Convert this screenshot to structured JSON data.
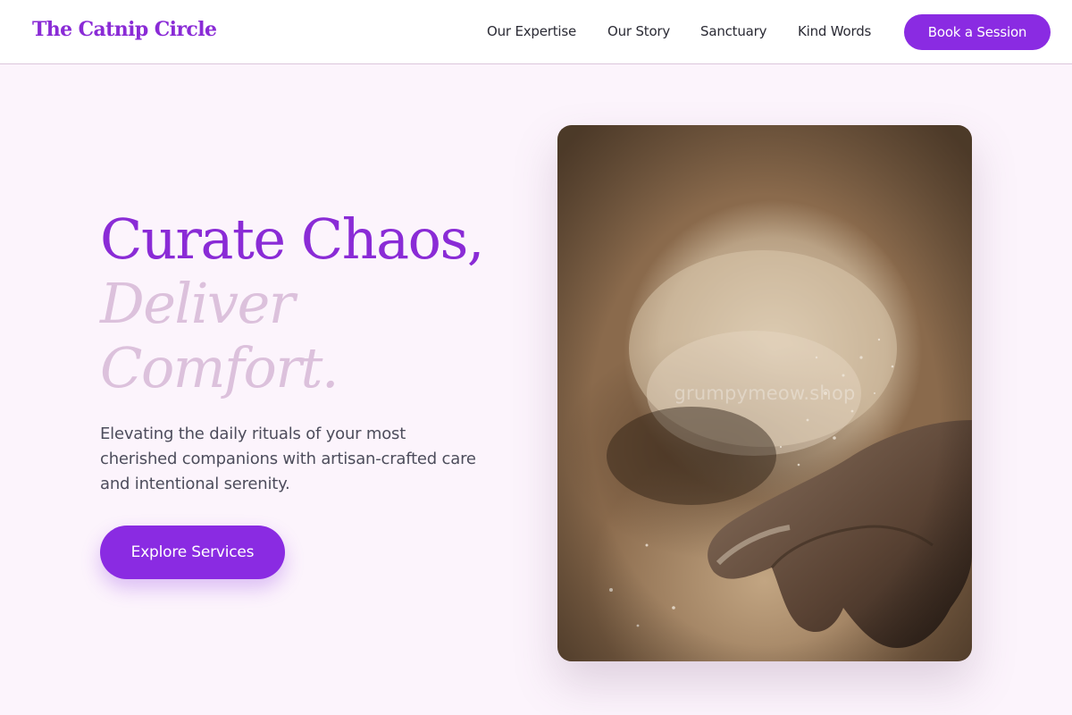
{
  "brand": {
    "name": "The Catnip Circle",
    "color": "#8a2bd6"
  },
  "nav": {
    "items": [
      {
        "label": "Our Expertise"
      },
      {
        "label": "Our Story"
      },
      {
        "label": "Sanctuary"
      },
      {
        "label": "Kind Words"
      }
    ],
    "cta_label": "Book a Session"
  },
  "hero": {
    "title_line1": "Curate Chaos,",
    "title_line2": "Deliver",
    "title_line3": "Comfort.",
    "subtitle": "Elevating the daily rituals of your most cherished companions with artisan-crafted care and intentional serenity.",
    "cta_label": "Explore Services",
    "image": {
      "description_icon": "photo-flour-hands",
      "watermark": "grumpymeow.shop"
    }
  },
  "colors": {
    "accent": "#8a2be2",
    "page_background": "#fcf4fc",
    "title_muted": "#dcc1dc",
    "body_text": "#4d4d5c"
  }
}
